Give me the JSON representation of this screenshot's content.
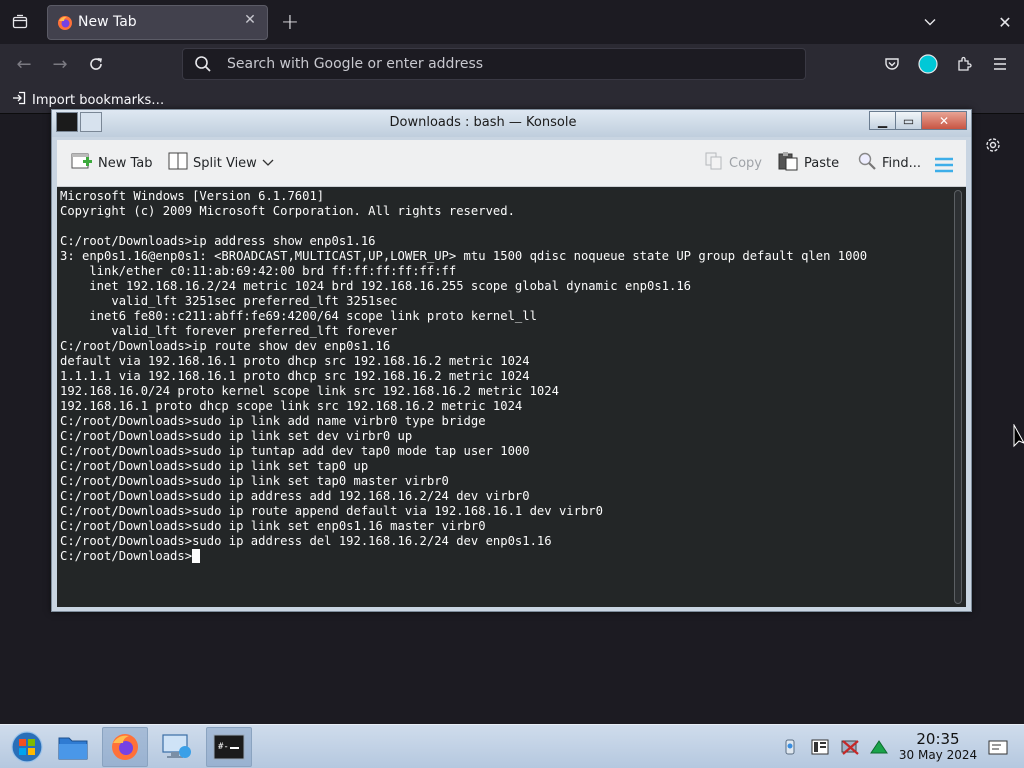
{
  "firefox": {
    "tab_title": "New Tab",
    "url_placeholder": "Search with Google or enter address",
    "import_bookmarks": "Import bookmarks…",
    "colors": {
      "toolbar": "#2b2a33",
      "tabbar": "#1c1b22",
      "account_badge": "#00c8d7"
    }
  },
  "konsole": {
    "title": "Downloads : bash — Konsole",
    "toolbar": {
      "new_tab": "New Tab",
      "split_view": "Split View",
      "copy": "Copy",
      "paste": "Paste",
      "find": "Find..."
    },
    "terminal_lines": [
      "Microsoft Windows [Version 6.1.7601]",
      "Copyright (c) 2009 Microsoft Corporation. All rights reserved.",
      "",
      "C:/root/Downloads>ip address show enp0s1.16",
      "3: enp0s1.16@enp0s1: <BROADCAST,MULTICAST,UP,LOWER_UP> mtu 1500 qdisc noqueue state UP group default qlen 1000",
      "    link/ether c0:11:ab:69:42:00 brd ff:ff:ff:ff:ff:ff",
      "    inet 192.168.16.2/24 metric 1024 brd 192.168.16.255 scope global dynamic enp0s1.16",
      "       valid_lft 3251sec preferred_lft 3251sec",
      "    inet6 fe80::c211:abff:fe69:4200/64 scope link proto kernel_ll",
      "       valid_lft forever preferred_lft forever",
      "C:/root/Downloads>ip route show dev enp0s1.16",
      "default via 192.168.16.1 proto dhcp src 192.168.16.2 metric 1024",
      "1.1.1.1 via 192.168.16.1 proto dhcp src 192.168.16.2 metric 1024",
      "192.168.16.0/24 proto kernel scope link src 192.168.16.2 metric 1024",
      "192.168.16.1 proto dhcp scope link src 192.168.16.2 metric 1024",
      "C:/root/Downloads>sudo ip link add name virbr0 type bridge",
      "C:/root/Downloads>sudo ip link set dev virbr0 up",
      "C:/root/Downloads>sudo ip tuntap add dev tap0 mode tap user 1000",
      "C:/root/Downloads>sudo ip link set tap0 up",
      "C:/root/Downloads>sudo ip link set tap0 master virbr0",
      "C:/root/Downloads>sudo ip address add 192.168.16.2/24 dev virbr0",
      "C:/root/Downloads>sudo ip route append default via 192.168.16.1 dev virbr0",
      "C:/root/Downloads>sudo ip link set enp0s1.16 master virbr0",
      "C:/root/Downloads>sudo ip address del 192.168.16.2/24 dev enp0s1.16"
    ],
    "prompt": "C:/root/Downloads>",
    "colors": {
      "terminal_bg": "#232627",
      "terminal_fg": "#fcfcfc",
      "hamburger": "#3daee9"
    }
  },
  "taskbar": {
    "icons": [
      "windows-start-orb",
      "file-explorer",
      "firefox",
      "remote-desktop",
      "konsole"
    ],
    "clock_time": "20:35",
    "clock_date": "30 May 2024"
  }
}
